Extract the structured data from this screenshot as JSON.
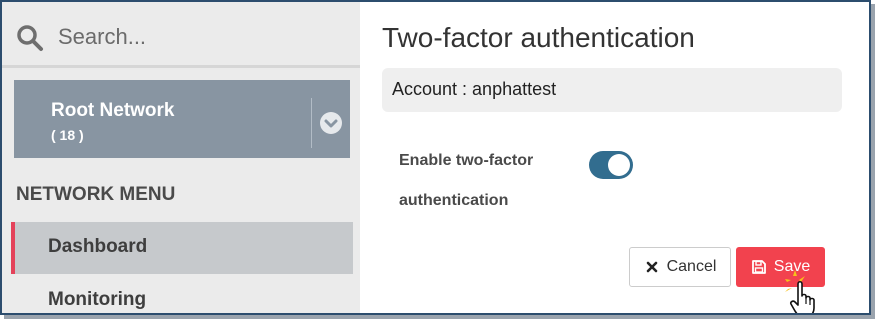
{
  "search": {
    "placeholder": "Search..."
  },
  "network": {
    "name": "Root Network",
    "count": "( 18 )"
  },
  "menu": {
    "heading": "NETWORK MENU",
    "items": [
      {
        "label": "Dashboard",
        "active": true
      },
      {
        "label": "Monitoring",
        "active": false
      }
    ]
  },
  "main": {
    "title": "Two-factor authentication",
    "account": "Account : anphattest",
    "toggle": {
      "label_line1": "Enable two-factor",
      "label_line2": "authentication",
      "enabled": true
    },
    "buttons": {
      "cancel": "Cancel",
      "save": "Save"
    }
  },
  "colors": {
    "accent": "#e4425a",
    "network_box": "#8895a2",
    "toggle_on": "#326d8f",
    "save_button": "#f2424e",
    "frame_border": "#2c4d6e"
  },
  "icons": {
    "search": "search-icon",
    "chevron": "chevron-down-icon",
    "cancel": "close-icon",
    "save": "floppy-disk-icon",
    "cursor": "hand-pointer-icon"
  }
}
